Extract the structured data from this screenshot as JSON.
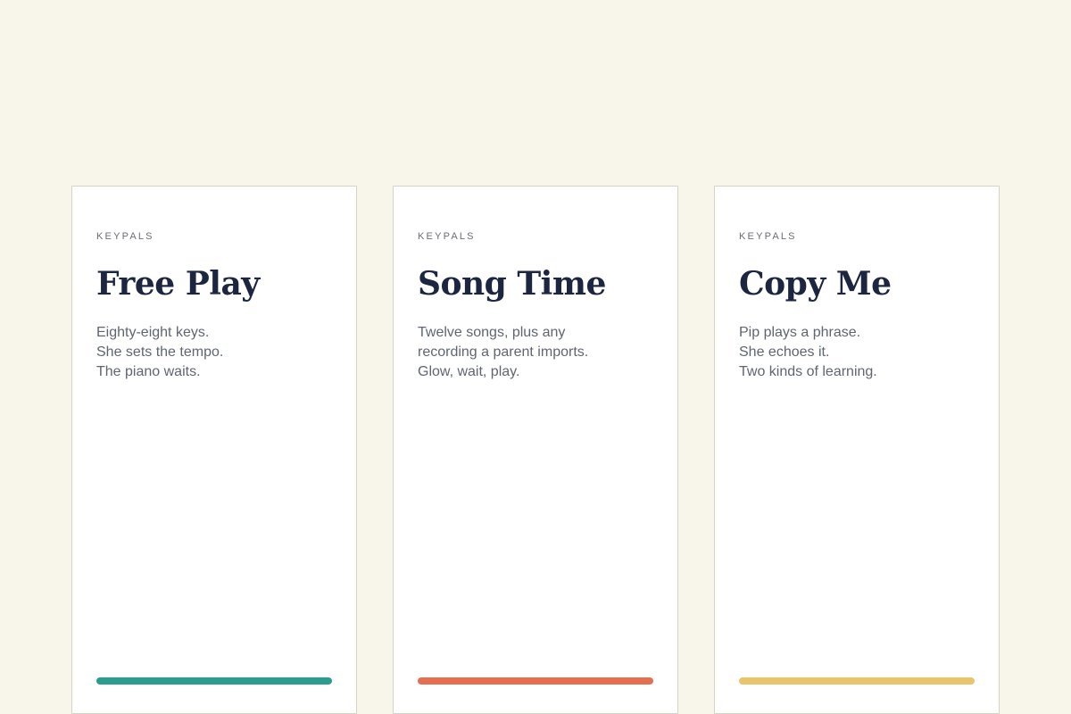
{
  "cards": [
    {
      "brand": "KEYPALS",
      "title": "Free Play",
      "lines": [
        "Eighty-eight keys.",
        "She sets the tempo.",
        "The piano waits."
      ],
      "accent_color": "#2a9d8f"
    },
    {
      "brand": "KEYPALS",
      "title": "Song Time",
      "lines": [
        "Twelve songs, plus any",
        "recording a parent imports.",
        "Glow, wait, play."
      ],
      "accent_color": "#e76f51"
    },
    {
      "brand": "KEYPALS",
      "title": "Copy Me",
      "lines": [
        "Pip plays a phrase.",
        "She echoes it.",
        "Two kinds of learning."
      ],
      "accent_color": "#e9c46a"
    }
  ]
}
